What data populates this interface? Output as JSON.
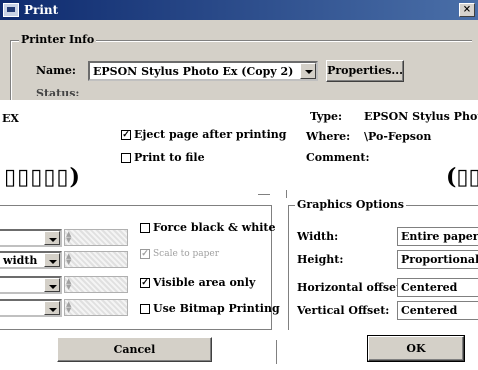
{
  "window": {
    "title": "Print",
    "close_glyph": "×"
  },
  "printer_info": {
    "group_label": "Printer Info",
    "name_label": "Name:",
    "name_value": "EPSON Stylus Photo Ex (Copy 2)",
    "properties_button": "Properties...",
    "status_partial": "Status:"
  },
  "left_fragment": "EX",
  "eject_after_printing": {
    "label": "Eject page after printing",
    "checked": true
  },
  "print_to_file": {
    "label": "Print to file",
    "checked": false
  },
  "type_label": "Type:",
  "type_value": "EPSON Stylus Photo",
  "where_label": "Where:",
  "where_value": "\\Po-Fepson",
  "comment_label": "Comment:",
  "placeholder_left": "▯▯▯▯▯)",
  "placeholder_right": "(▯▯",
  "left_options": {
    "width_fragment": "width",
    "force_black_white": {
      "label": "Force black & white",
      "checked": false
    },
    "scale_to_paper": {
      "label": "Scale to paper",
      "checked": true,
      "enabled": false
    },
    "visible_area_only": {
      "label": "Visible area only",
      "checked": true
    },
    "use_bitmap_printing": {
      "label": "Use Bitmap Printing",
      "checked": false
    }
  },
  "graphics_options": {
    "group_label": "Graphics Options",
    "rows": [
      {
        "label": "Width:",
        "value": "Entire paper"
      },
      {
        "label": "Height:",
        "value": "Proportional to"
      },
      {
        "label": "Horizontal offset:",
        "value": "Centered"
      },
      {
        "label": "Vertical Offset:",
        "value": "Centered"
      }
    ]
  },
  "buttons": {
    "cancel": "Cancel",
    "ok": "OK"
  },
  "colors": {
    "title_start": "#0e2a6e",
    "title_end": "#4a6fa8",
    "panel": "#d4d0c8"
  }
}
